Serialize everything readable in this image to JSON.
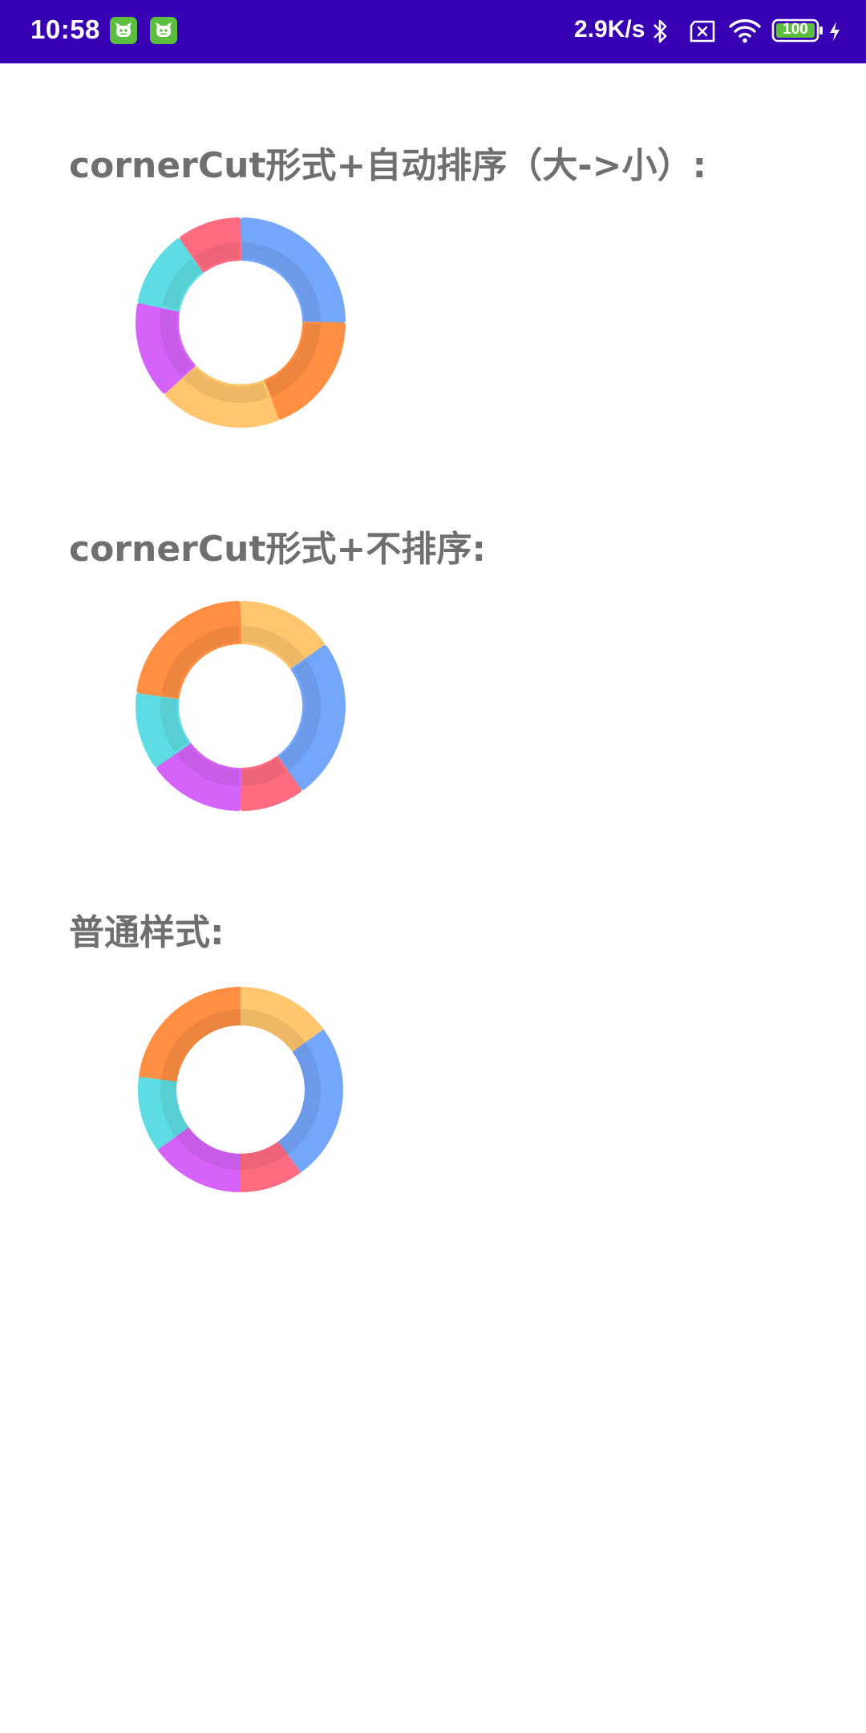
{
  "status_bar": {
    "time": "10:58",
    "net_speed": "2.9K/s",
    "battery_level": "100",
    "icons": [
      "app-notification-icon",
      "app-notification-icon",
      "bluetooth-icon",
      "sim-icon",
      "wifi-icon",
      "battery-icon",
      "charging-icon"
    ],
    "background_color": "#3700B3"
  },
  "colors": {
    "blue": "#74A6FA",
    "orange": "#FF8F43",
    "yellow": "#FFC66E",
    "purple": "#D563F9",
    "cyan": "#5DDDE3",
    "red": "#FF6B81"
  },
  "sections": [
    {
      "title": "cornerCut形式+自动排序（大->小）:",
      "style": "cornerCut",
      "chart_data": {
        "type": "pie",
        "variant": "donut",
        "order": "sorted-descending",
        "slices": [
          {
            "color": "blue",
            "value": 25
          },
          {
            "color": "orange",
            "value": 19
          },
          {
            "color": "yellow",
            "value": 19
          },
          {
            "color": "purple",
            "value": 15
          },
          {
            "color": "cyan",
            "value": 12
          },
          {
            "color": "red",
            "value": 10
          }
        ]
      }
    },
    {
      "title": "cornerCut形式+不排序:",
      "style": "cornerCut",
      "chart_data": {
        "type": "pie",
        "variant": "donut",
        "order": "unsorted",
        "slices": [
          {
            "color": "yellow",
            "value": 15
          },
          {
            "color": "blue",
            "value": 25
          },
          {
            "color": "red",
            "value": 10
          },
          {
            "color": "purple",
            "value": 15
          },
          {
            "color": "cyan",
            "value": 12
          },
          {
            "color": "orange",
            "value": 23
          }
        ]
      }
    },
    {
      "title": "普通样式:",
      "style": "normal",
      "chart_data": {
        "type": "pie",
        "variant": "donut",
        "order": "unsorted",
        "slices": [
          {
            "color": "yellow",
            "value": 15
          },
          {
            "color": "blue",
            "value": 25
          },
          {
            "color": "red",
            "value": 10
          },
          {
            "color": "purple",
            "value": 15
          },
          {
            "color": "cyan",
            "value": 12
          },
          {
            "color": "orange",
            "value": 23
          }
        ]
      }
    }
  ]
}
